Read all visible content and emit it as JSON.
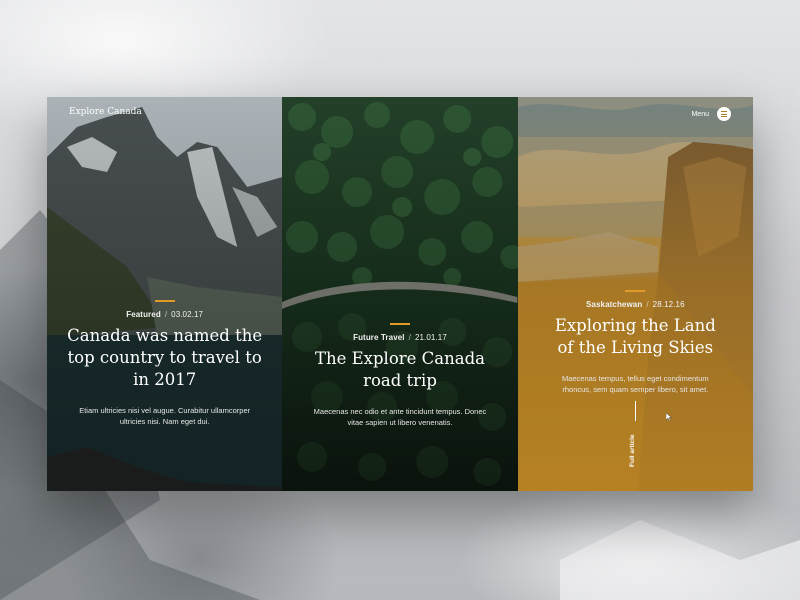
{
  "header": {
    "brand": "Explore Canada",
    "menu_label": "Menu"
  },
  "articles": [
    {
      "category": "Featured",
      "separator": "/",
      "date": "03.02.17",
      "title": "Canada was named the top country to travel to in 2017",
      "excerpt": "Etiam ultricies nisi vel augue. Curabitur ullamcorper ultricies nisi. Nam eget dui."
    },
    {
      "category": "Future Travel",
      "separator": "/",
      "date": "21.01.17",
      "title": "The Explore Canada road trip",
      "excerpt": "Maecenas nec odio et ante tincidunt tempus. Donec vitae sapien ut libero venenatis."
    },
    {
      "category": "Saskatchewan",
      "separator": "/",
      "date": "28.12.16",
      "title": "Exploring the Land of the Living Skies",
      "excerpt": "Maecenas tempus, tellus eget condimentum rhoncus, sem quam semper libero, sit amet.",
      "cta": "Full article"
    }
  ],
  "colors": {
    "accent": "#e09a26",
    "gold_panel": "#b07f22",
    "text": "#ffffff"
  }
}
